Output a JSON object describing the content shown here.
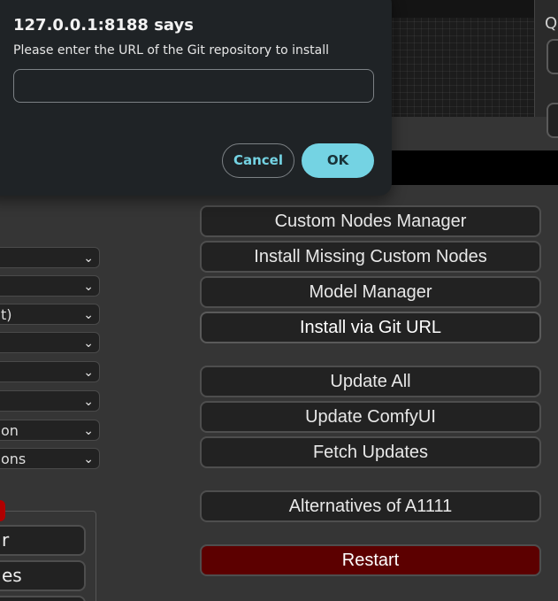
{
  "dialog": {
    "title": "127.0.0.1:8188 says",
    "message": "Please enter the URL of the Git repository to install",
    "input_value": "",
    "cancel_label": "Cancel",
    "ok_label": "OK"
  },
  "canvas": {
    "side_char": "Q"
  },
  "left_panel": {
    "selects": [
      {
        "label": ""
      },
      {
        "label": ""
      },
      {
        "label": "t)"
      },
      {
        "label": ""
      },
      {
        "label": ""
      },
      {
        "label": ""
      },
      {
        "label": "on"
      },
      {
        "label": "ons"
      }
    ],
    "buttons": [
      {
        "label": "r"
      },
      {
        "label": "es"
      },
      {
        "label": ""
      }
    ],
    "chevron": "⌄"
  },
  "manager": {
    "buttons": [
      {
        "label": "Custom Nodes Manager"
      },
      {
        "label": "Install Missing Custom Nodes"
      },
      {
        "label": "Model Manager"
      },
      {
        "label": "Install via Git URL"
      },
      {
        "label": "Update All"
      },
      {
        "label": "Update ComfyUI"
      },
      {
        "label": "Fetch Updates"
      },
      {
        "label": "Alternatives of A1111"
      },
      {
        "label": "Restart"
      }
    ]
  },
  "colors": {
    "background": "#353535",
    "button_bg": "#222222",
    "restart_bg": "#5c0000",
    "dialog_bg": "#1f2326",
    "dialog_accent": "#74d3e3"
  }
}
